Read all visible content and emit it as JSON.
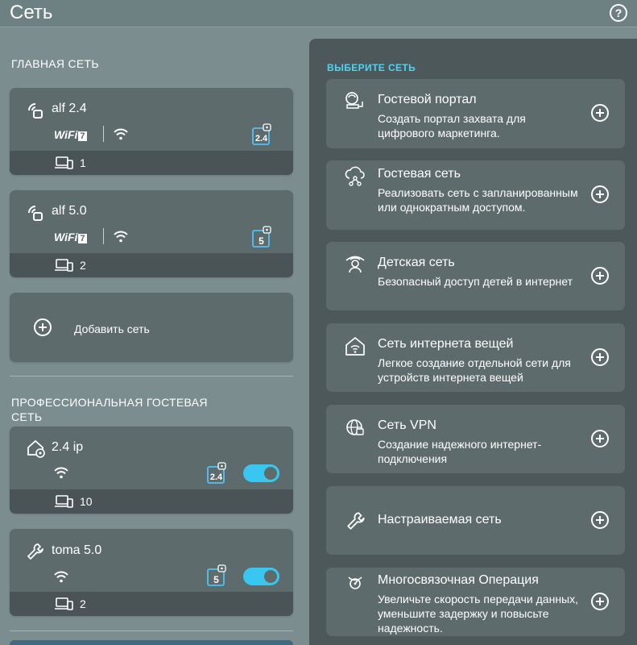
{
  "header": {
    "title": "Сеть",
    "help": "?"
  },
  "main_networks": {
    "title": "ГЛАВНАЯ СЕТЬ",
    "items": [
      {
        "name": "alf 2.4",
        "band": "2.4",
        "wifi_label": "WiFi",
        "wifi_gen": "7",
        "clients": "1"
      },
      {
        "name": "alf 5.0",
        "band": "5",
        "wifi_label": "WiFi",
        "wifi_gen": "7",
        "clients": "2"
      }
    ],
    "add_label": "Добавить сеть"
  },
  "pro_guest": {
    "title_line1": "ПРОФЕССИОНАЛЬНАЯ ГОСТЕВАЯ",
    "title_line2": "СЕТЬ",
    "items": [
      {
        "name": "2.4 ip",
        "band": "2.4",
        "clients": "10",
        "enabled": true
      },
      {
        "name": "toma 5.0",
        "band": "5",
        "clients": "2",
        "enabled": true
      }
    ]
  },
  "choose": {
    "title": "ВЫБЕРИТЕ СЕТЬ",
    "options": [
      {
        "title": "Гостевой портал",
        "desc": "Создать портал захвата для цифрового маркетинга.",
        "icon": "portal-icon"
      },
      {
        "title": "Гостевая сеть",
        "desc": "Реализовать сеть с запланированным или однократным доступом.",
        "icon": "guest-network-icon"
      },
      {
        "title": "Детская сеть",
        "desc": "Безопасный доступ детей в интернет",
        "icon": "kids-icon"
      },
      {
        "title": "Сеть интернета вещей",
        "desc": "Легкое создание отдельной сети для устройств интернета вещей",
        "icon": "iot-home-icon"
      },
      {
        "title": "Сеть VPN",
        "desc": "Создание надежного интернет-подключения",
        "icon": "vpn-globe-icon"
      },
      {
        "title": "Настраиваемая сеть",
        "desc": "",
        "icon": "wrench-icon"
      },
      {
        "title": "Многосвязочная Операция",
        "desc": "Увеличьте скорость передачи данных, уменьшите задержку и повысьте надежность.",
        "icon": "multilink-icon"
      }
    ]
  },
  "colors": {
    "accent": "#39c6f0",
    "band_badge": "#4fc3f7",
    "background": "#7b8d8f",
    "card": "#5e6b6d"
  }
}
